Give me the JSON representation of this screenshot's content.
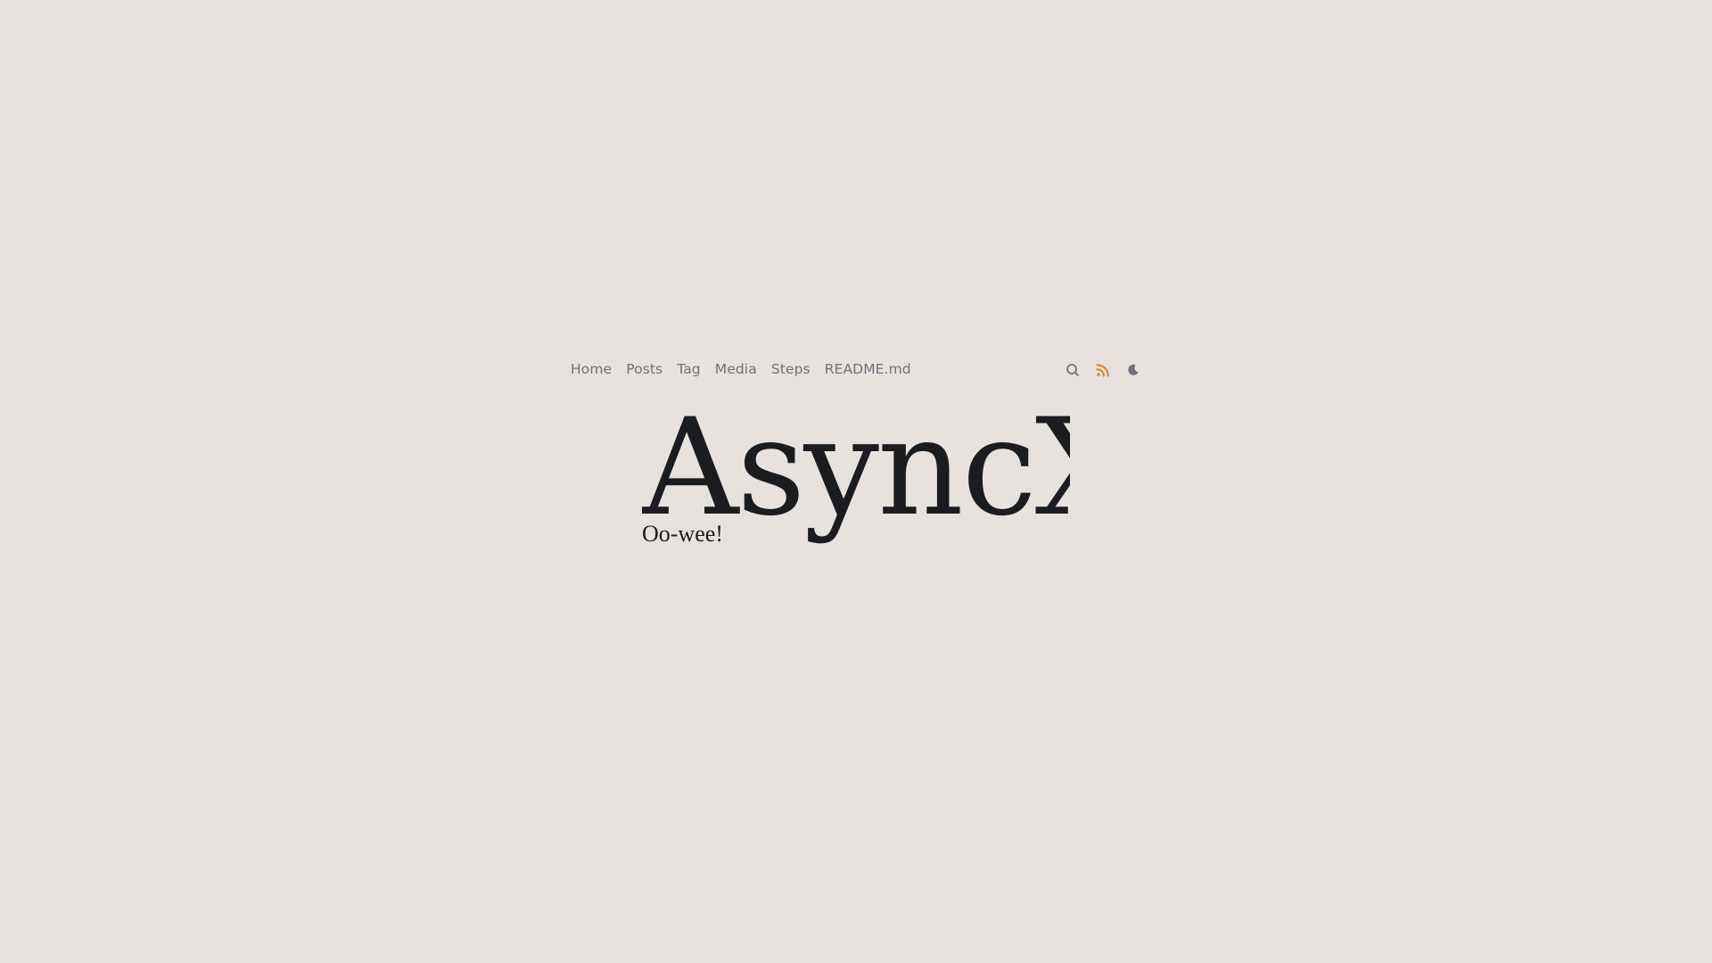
{
  "nav": {
    "items": [
      {
        "label": "Home"
      },
      {
        "label": "Posts"
      },
      {
        "label": "Tag"
      },
      {
        "label": "Media"
      },
      {
        "label": "Steps"
      },
      {
        "label": "README.md"
      }
    ]
  },
  "toolbar": {
    "icons": [
      "search-icon",
      "rss-icon",
      "moon-icon"
    ],
    "rss_color": "#e07b2e",
    "icon_color": "#70717a"
  },
  "hero": {
    "title": "AsyncX",
    "subtitle": "Oo-wee!"
  },
  "theme": {
    "background": "#e7e2de",
    "text": "#1b1c20",
    "nav_text": "#70717a"
  }
}
